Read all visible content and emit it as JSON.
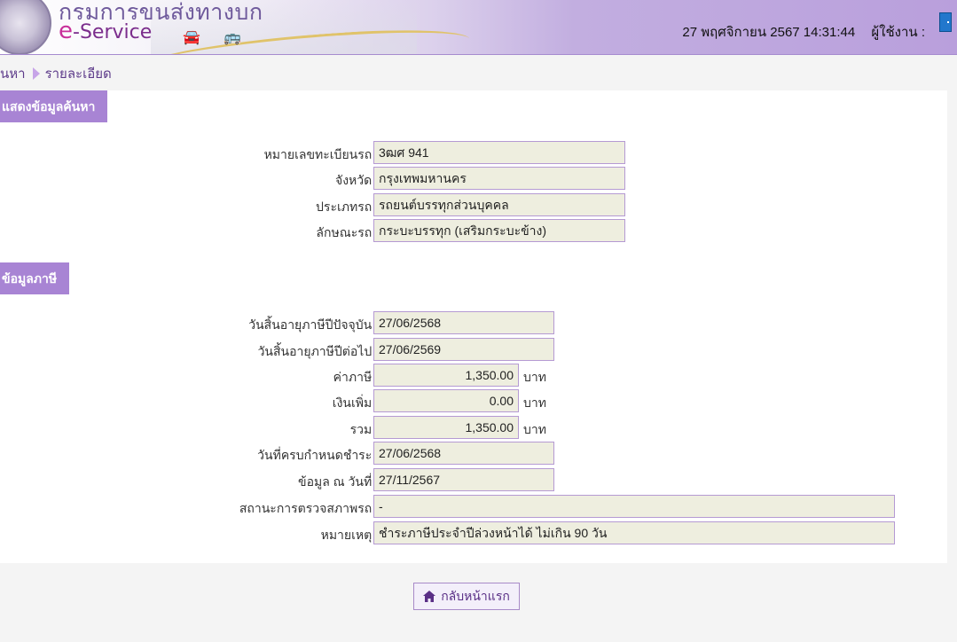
{
  "header": {
    "logo_thai": "กรมการขนส่งทางบก",
    "logo_e": "e",
    "logo_service": "-Service",
    "datetime": "27 พฤศจิกายน 2567 14:31:44",
    "user_label": "ผู้ใช้งาน :",
    "icons": [
      "department-seal",
      "car-icon",
      "bus-icon",
      "logout-door-icon"
    ]
  },
  "breadcrumb": {
    "search": "นหา",
    "detail": "รายละเอียด"
  },
  "section_search": {
    "title": "แสดงข้อมูลค้นหา",
    "rows": [
      {
        "label": "หมายเลขทะเบียนรถ :",
        "value": "3ฒศ 941"
      },
      {
        "label": "จังหวัด :",
        "value": "กรุงเทพมหานคร"
      },
      {
        "label": "ประเภทรถ :",
        "value": "รถยนต์บรรทุกส่วนบุคคล"
      },
      {
        "label": "ลักษณะรถ :",
        "value": "กระบะบรรทุก (เสริมกระบะข้าง)"
      }
    ]
  },
  "section_tax": {
    "title": "ข้อมูลภาษี",
    "rows": [
      {
        "label": "วันสิ้นอายุภาษีปีปัจจุบัน :",
        "value": "27/06/2568"
      },
      {
        "label": "วันสิ้นอายุภาษีปีต่อไป :",
        "value": "27/06/2569"
      },
      {
        "label": "ค่าภาษี :",
        "value": "1,350.00",
        "unit": "บาท"
      },
      {
        "label": "เงินเพิ่ม :",
        "value": "0.00",
        "unit": "บาท"
      },
      {
        "label": "รวม :",
        "value": "1,350.00",
        "unit": "บาท"
      },
      {
        "label": "วันที่ครบกำหนดชำระ :",
        "value": "27/06/2568"
      },
      {
        "label": "ข้อมูล ณ วันที่ :",
        "value": "27/11/2567"
      },
      {
        "label": "สถานะการตรวจสภาพรถ :",
        "value": "-"
      },
      {
        "label": "หมายเหตุ :",
        "value": "ชำระภาษีประจำปีล่วงหน้าได้ ไม่เกิน 90 วัน"
      }
    ]
  },
  "home_button": {
    "label": "กลับหน้าแรก",
    "icon": "home-icon"
  },
  "colors": {
    "accent": "#a884d4",
    "field_bg": "#eeeedf",
    "field_border": "#b59ad3"
  }
}
